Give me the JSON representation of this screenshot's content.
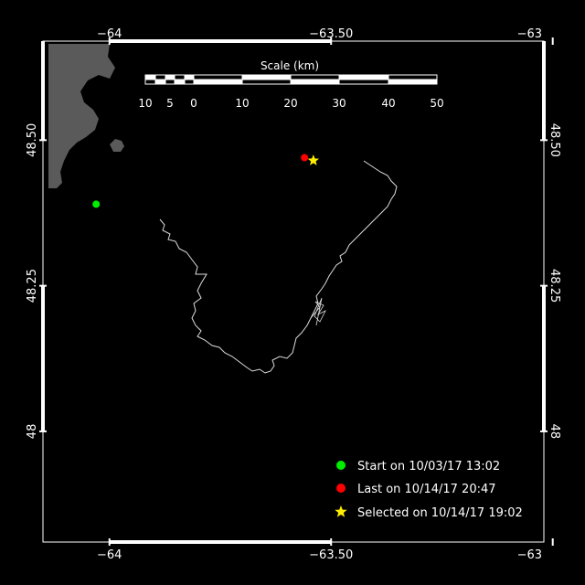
{
  "map": {
    "lon_range": [
      -64.15,
      -63.02
    ],
    "lat_range": [
      47.81,
      48.67
    ],
    "top_ticks": [
      {
        "lon": -64,
        "label": "−64"
      },
      {
        "lon": -63.5,
        "label": "−63.50"
      },
      {
        "lon": -63,
        "label": "−63"
      }
    ],
    "bottom_ticks": [
      {
        "lon": -64,
        "label": "−64"
      },
      {
        "lon": -63.5,
        "label": "−63.50"
      },
      {
        "lon": -63,
        "label": "−63"
      }
    ],
    "left_ticks": [
      {
        "lat": 48.5,
        "label": "48.50"
      },
      {
        "lat": 48.25,
        "label": "48.25"
      },
      {
        "lat": 48.0,
        "label": "48"
      }
    ],
    "right_ticks": [
      {
        "lat": 48.5,
        "label": "48.50"
      },
      {
        "lat": 48.25,
        "label": "48.25"
      },
      {
        "lat": 48.0,
        "label": "48"
      }
    ],
    "colors": {
      "background": "#000000",
      "land": "#5a5a5a",
      "track": "#dddddd",
      "start": "#00ee00",
      "last": "#ff0000",
      "selected": "#ffee00"
    },
    "scale": {
      "title": "Scale (km)",
      "labels": [
        "10",
        "5",
        "0",
        "10",
        "20",
        "30",
        "40",
        "50"
      ]
    },
    "legend": [
      {
        "marker": "start-dot",
        "text": "Start on 10/03/17 13:02"
      },
      {
        "marker": "last-dot",
        "text": "Last on 10/14/17 20:47"
      },
      {
        "marker": "selected-star",
        "text": "Selected on 10/14/17 19:02"
      }
    ],
    "start_point": {
      "lon": -64.03,
      "lat": 48.39
    },
    "last_point": {
      "lon": -63.56,
      "lat": 48.47
    },
    "selected_point": {
      "lon": -63.54,
      "lat": 48.465
    }
  }
}
